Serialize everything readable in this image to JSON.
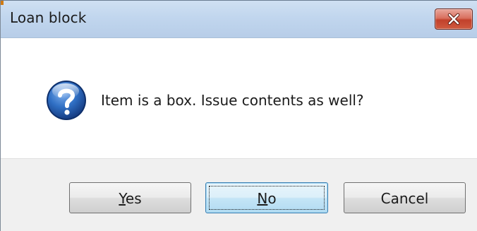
{
  "window": {
    "title": "Loan block",
    "close_icon": "close-icon"
  },
  "message": {
    "icon": "question-icon",
    "text": "Item is a box. Issue contents as well?"
  },
  "buttons": {
    "yes": {
      "mnemonic": "Y",
      "rest": "es"
    },
    "no": {
      "mnemonic": "N",
      "rest": "o"
    },
    "cancel": "Cancel"
  },
  "colors": {
    "titlebar": "#c1d6ee",
    "close_button": "#c2412b",
    "question_icon": "#1f5fb4",
    "button_bar": "#f0f0f0",
    "default_button_border": "#3c7fb1"
  }
}
